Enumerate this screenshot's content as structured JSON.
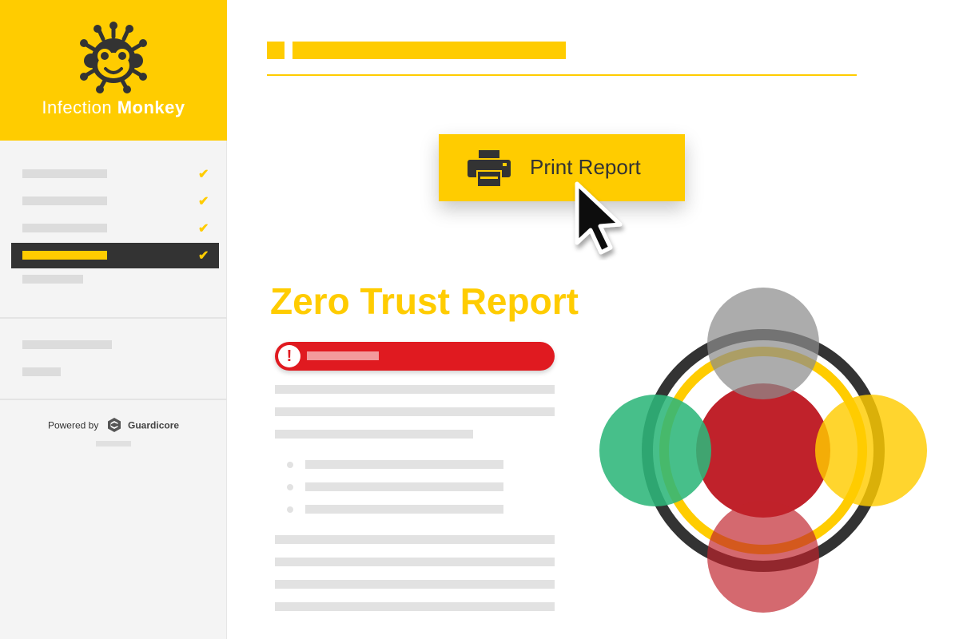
{
  "brand": {
    "name_light": "Infection",
    "name_bold": "Monkey"
  },
  "sidebar": {
    "items": [
      {
        "checked": true,
        "active": false
      },
      {
        "checked": true,
        "active": false
      },
      {
        "checked": true,
        "active": false
      },
      {
        "checked": true,
        "active": true
      },
      {
        "checked": false,
        "active": false
      }
    ],
    "check_glyph": "✔",
    "footer": {
      "powered_by": "Powered by",
      "company": "Guardicore"
    }
  },
  "toolbar": {
    "print_label": "Print Report",
    "print_icon": "printer-icon"
  },
  "report": {
    "title": "Zero Trust Report",
    "alert_glyph": "!",
    "alert_icon": "exclamation-icon"
  },
  "colors": {
    "accent": "#ffcc00",
    "dark": "#333333",
    "alert": "#e01a20",
    "green": "#2db67a",
    "gray": "#8c8c8c",
    "red": "#c0222b"
  }
}
